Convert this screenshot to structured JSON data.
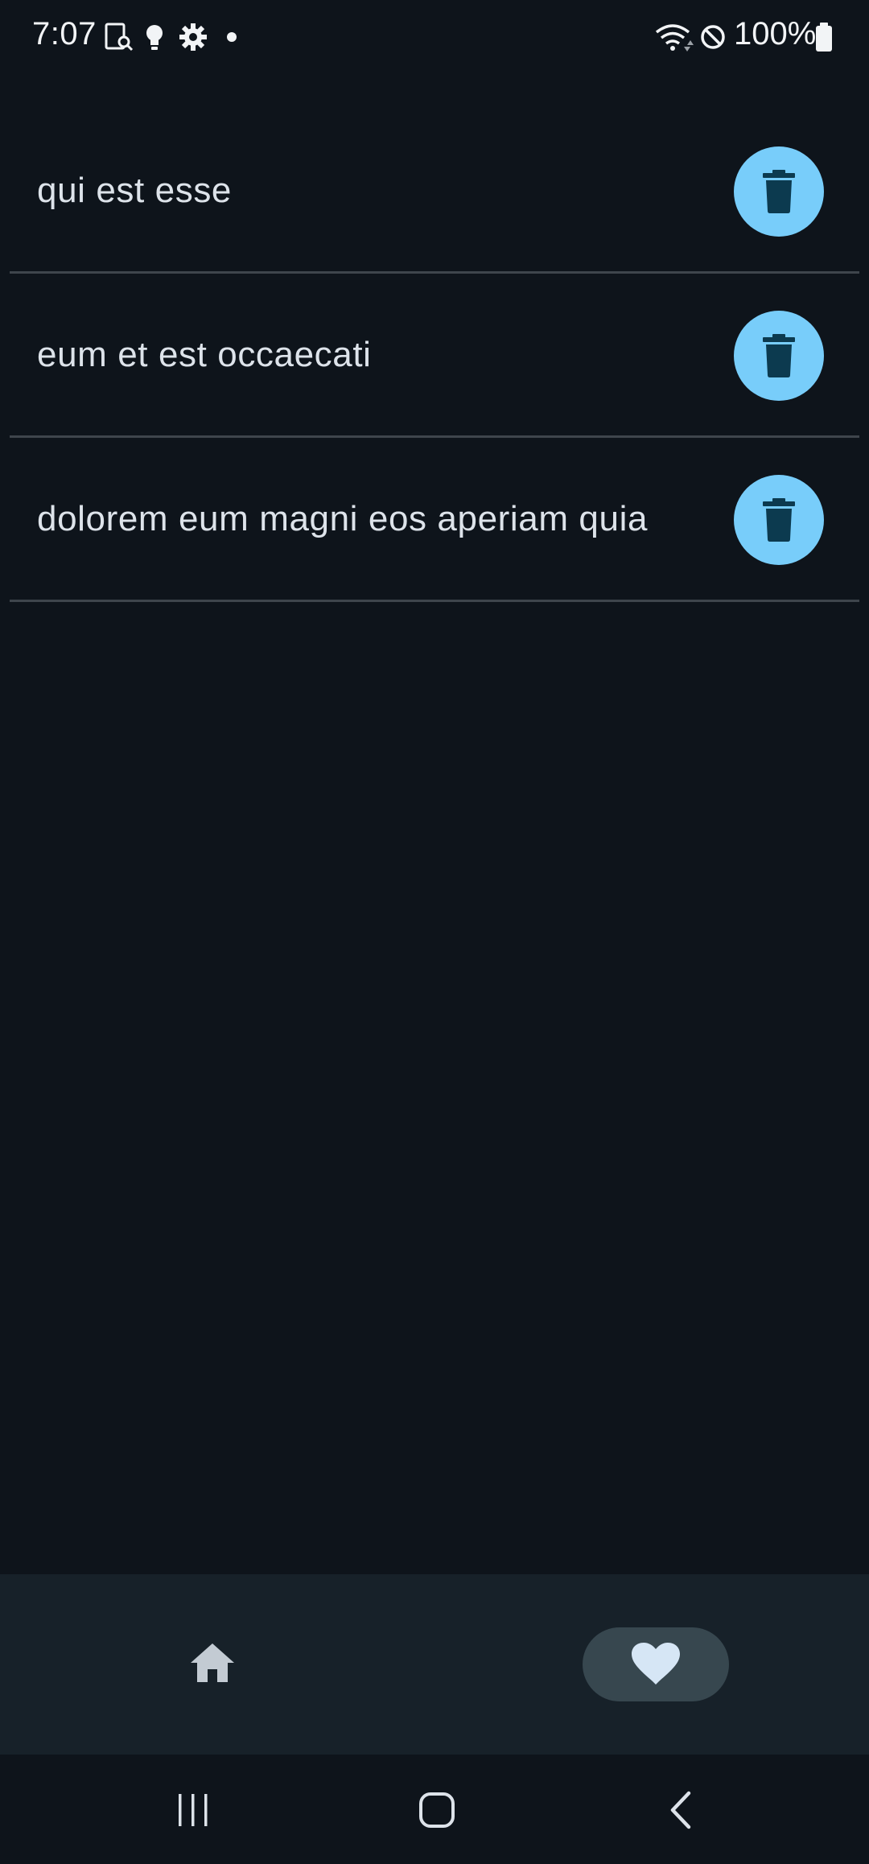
{
  "status_bar": {
    "time": "7:07",
    "battery": "100%",
    "icons": [
      "screenshot-search-icon",
      "lightbulb-icon",
      "gear-icon",
      "dot-icon",
      "wifi-icon",
      "do-not-disturb-icon",
      "battery-icon"
    ]
  },
  "list": {
    "items": [
      {
        "title": "qui est esse"
      },
      {
        "title": "eum et est occaecati"
      },
      {
        "title": "dolorem eum magni eos aperiam quia"
      }
    ]
  },
  "bottom_nav": {
    "items": [
      {
        "icon": "home-icon",
        "selected": false
      },
      {
        "icon": "heart-icon",
        "selected": true
      }
    ]
  },
  "colors": {
    "background": "#0e141b",
    "accent": "#78cdfa",
    "nav_background": "#172129",
    "nav_selected_pill": "#37474f",
    "divider": "#3e454c"
  }
}
